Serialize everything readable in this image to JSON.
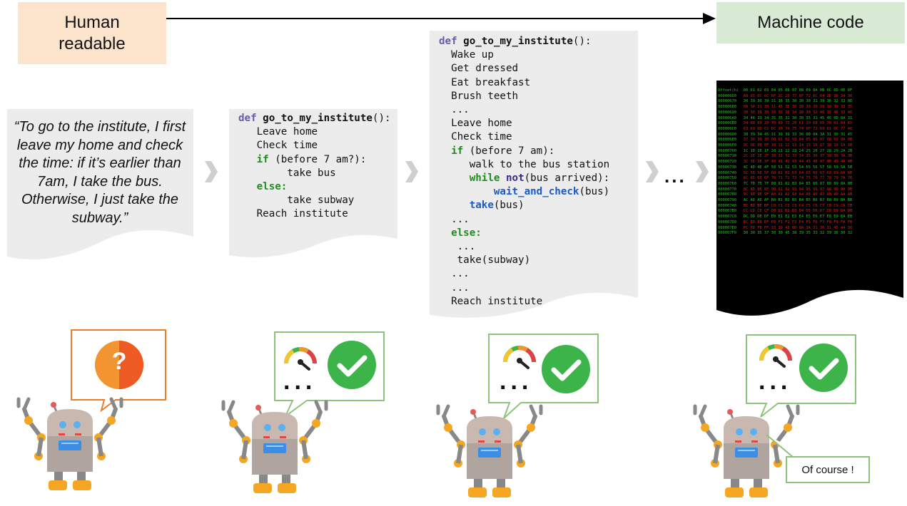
{
  "labels": {
    "human_readable": "Human readable",
    "machine_code": "Machine code"
  },
  "quote": "“To go to the institute, I first leave my home and check the time: if it’s earlier than 7am, I take the bus. Otherwise, I just take the subway.”",
  "code1": {
    "def_kw": "def",
    "func": "go_to_my_institute",
    "sig_tail": "():",
    "line_leave": "Leave home",
    "line_check": "Check time",
    "if_kw": "if",
    "if_cond": " (before 7 am?):",
    "take_bus": "take bus",
    "else_kw": "else:",
    "take_subway": "take subway",
    "reach": "Reach institute"
  },
  "code2": {
    "def_kw": "def",
    "func": "go_to_my_institute",
    "sig_tail": "():",
    "wake": "Wake up",
    "dressed": "Get dressed",
    "breakfast": "Eat breakfast",
    "teeth": "Brush teeth",
    "ellipsis": "...",
    "leave": "Leave home",
    "check": "Check time",
    "if_kw": "if",
    "if_cond": " (before 7 am):",
    "walk": "walk to the bus station",
    "while_kw": "while",
    "not_kw": "not",
    "while_cond": "(bus arrived):",
    "wait_fn": "wait_and_check",
    "wait_arg": "(bus)",
    "take_fn": "take",
    "take_arg": "(bus)",
    "else_kw": "else:",
    "indent_ellipsis": " ...",
    "take_subway": " take(subway)",
    "reach": "Reach institute"
  },
  "hex_dump": {
    "header": "Offset(h)  00 01 02 03 04 05 06 07 08 09 0A 0B 0C 0D 0E 0F",
    "offsets": [
      "00000660",
      "00000670",
      "00000680",
      "00000690",
      "000006A0",
      "000006B0",
      "000006C0",
      "000006D0",
      "000006E0",
      "000006F0",
      "00000700",
      "00000710",
      "00000720",
      "00000730",
      "00000740",
      "00000750",
      "00000760",
      "00000770",
      "00000780",
      "00000790",
      "000007A0",
      "000007B0",
      "000007C0",
      "000007D0",
      "000007E0",
      "000007F0"
    ],
    "rows": [
      "A8 65 6C 6C 6F 2C 20 77 6F 72 6C 64 2E 36 34 30",
      "30 39 30 39 31 36 35 30 30 30 31 39 36 32 33 0D",
      "0A 3A 31 30 31 45 35 30 30 30 30 39 30 39 33 35",
      "30 30 38 30 39 33 36 34 30 30 32 46 35 46 33 46",
      "34 46 33 34 35 35 31 30 30 35 31 45 46 0D 0A 31",
      "34 68 69 20 70 69 73 20 61 20 68 65 78 61 64 65",
      "63 69 6D 61 6C 20 74 75 74 6F 72 69 61 6C 77 46",
      "38 39 34 45 31 39 39 33 36 0D 0A 3A 31 30 31 45",
      "37 30 30 30 00 01 02 03 04 05 06 07 08 09 0A 0B",
      "0C 0D 0E 0F 10 11 12 13 14 15 16 17 18 19 1A 1B",
      "1C 1D 1E 1F 20 21 22 23 24 25 26 27 28 29 2A 2B",
      "2C 2D 2E 2F 30 31 32 33 34 35 36 37 38 39 3A 3B",
      "3C 3D 3E 3F 40 41 42 43 44 45 46 47 48 49 4A 4B",
      "4C 4D 4E 4F 50 51 52 53 54 55 56 57 58 59 5A 5B",
      "5C 5D 5E 5F 60 61 62 63 64 65 66 67 68 69 6A 6B",
      "6C 6D 6E 6F 70 71 72 73 74 75 76 77 78 79 7A 7B",
      "7C 7D 7E 7F 80 81 82 83 84 85 86 87 88 89 8A 8B",
      "8C 8D 8E 8F 90 91 92 93 94 95 96 97 98 99 9A 9B",
      "9C 9D 9E 9F A0 A1 A2 A3 A4 A5 A6 A7 A8 A9 AA AB",
      "AC AD AE AF B0 B1 B2 B3 B4 B5 B6 B7 B8 B9 BA BB",
      "BC BD BE BF C0 C1 C2 C3 C4 C5 C6 C7 C8 C9 CA CB",
      "CC CD CE CF D0 D1 D2 D3 D4 D5 D6 D7 D8 D9 DA DB",
      "DC DD DE DF E0 E1 E2 E3 E4 E5 E6 E7 E8 E9 EA EB",
      "EC ED EE EF F0 F1 F2 F3 F4 F5 F6 F7 F8 F9 FA FB",
      "FC FD FE FF 33 39 43 0D 0A 3A 31 30 31 45 44 30",
      "30 30 35 37 30 30 45 38 39 35 33 32 39 36 30 32"
    ]
  },
  "ellipsis_text": "...",
  "bubble_dots": "...",
  "question_mark": "?",
  "of_course": "Of course !",
  "colors": {
    "human_box": "#fbe3cc",
    "machine_box": "#d8ead3",
    "doc_gray": "#ececec",
    "keyword_green": "#1e8e1e",
    "keyword_purple": "#6a5aa8",
    "function_blue": "#1a5cc4",
    "bubble_orange": "#ec7c2c",
    "bubble_green": "#8cc47c",
    "check_green": "#3cb44a"
  }
}
